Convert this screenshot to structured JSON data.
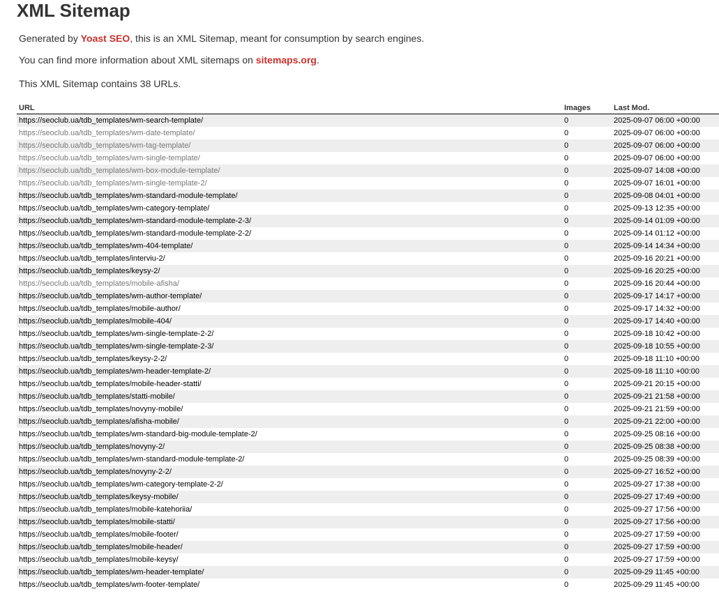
{
  "page": {
    "title": "XML Sitemap"
  },
  "intro": {
    "line1_prefix": "Generated by ",
    "line1_link": "Yoast SEO",
    "line1_suffix": ", this is an XML Sitemap, meant for consumption by search engines.",
    "line2_prefix": "You can find more information about XML sitemaps on ",
    "line2_link": "sitemaps.org",
    "line2_suffix": ".",
    "line3": "This XML Sitemap contains 38 URLs."
  },
  "colors": {
    "link_accent": "#c9302c",
    "row_stripe": "#eeeeee",
    "visited_link": "#777777"
  },
  "table": {
    "headers": {
      "url": "URL",
      "images": "Images",
      "last_mod": "Last Mod."
    },
    "rows": [
      {
        "url": "https://seoclub.ua/tdb_templates/wm-search-template/",
        "images": "0",
        "last_mod": "2025-09-07 06:00 +00:00",
        "visited": false
      },
      {
        "url": "https://seoclub.ua/tdb_templates/wm-date-template/",
        "images": "0",
        "last_mod": "2025-09-07 06:00 +00:00",
        "visited": true
      },
      {
        "url": "https://seoclub.ua/tdb_templates/wm-tag-template/",
        "images": "0",
        "last_mod": "2025-09-07 06:00 +00:00",
        "visited": true
      },
      {
        "url": "https://seoclub.ua/tdb_templates/wm-single-template/",
        "images": "0",
        "last_mod": "2025-09-07 06:00 +00:00",
        "visited": true
      },
      {
        "url": "https://seoclub.ua/tdb_templates/wm-box-module-template/",
        "images": "0",
        "last_mod": "2025-09-07 14:08 +00:00",
        "visited": true
      },
      {
        "url": "https://seoclub.ua/tdb_templates/wm-single-template-2/",
        "images": "0",
        "last_mod": "2025-09-07 16:01 +00:00",
        "visited": true
      },
      {
        "url": "https://seoclub.ua/tdb_templates/wm-standard-module-template/",
        "images": "0",
        "last_mod": "2025-09-08 04:01 +00:00",
        "visited": false
      },
      {
        "url": "https://seoclub.ua/tdb_templates/wm-category-template/",
        "images": "0",
        "last_mod": "2025-09-13 12:35 +00:00",
        "visited": false
      },
      {
        "url": "https://seoclub.ua/tdb_templates/wm-standard-module-template-2-3/",
        "images": "0",
        "last_mod": "2025-09-14 01:09 +00:00",
        "visited": false
      },
      {
        "url": "https://seoclub.ua/tdb_templates/wm-standard-module-template-2-2/",
        "images": "0",
        "last_mod": "2025-09-14 01:12 +00:00",
        "visited": false
      },
      {
        "url": "https://seoclub.ua/tdb_templates/wm-404-template/",
        "images": "0",
        "last_mod": "2025-09-14 14:34 +00:00",
        "visited": false
      },
      {
        "url": "https://seoclub.ua/tdb_templates/interviu-2/",
        "images": "0",
        "last_mod": "2025-09-16 20:21 +00:00",
        "visited": false
      },
      {
        "url": "https://seoclub.ua/tdb_templates/keysy-2/",
        "images": "0",
        "last_mod": "2025-09-16 20:25 +00:00",
        "visited": false
      },
      {
        "url": "https://seoclub.ua/tdb_templates/mobile-afisha/",
        "images": "0",
        "last_mod": "2025-09-16 20:44 +00:00",
        "visited": true
      },
      {
        "url": "https://seoclub.ua/tdb_templates/wm-author-template/",
        "images": "0",
        "last_mod": "2025-09-17 14:17 +00:00",
        "visited": false
      },
      {
        "url": "https://seoclub.ua/tdb_templates/mobile-author/",
        "images": "0",
        "last_mod": "2025-09-17 14:32 +00:00",
        "visited": false
      },
      {
        "url": "https://seoclub.ua/tdb_templates/mobile-404/",
        "images": "0",
        "last_mod": "2025-09-17 14:40 +00:00",
        "visited": false
      },
      {
        "url": "https://seoclub.ua/tdb_templates/wm-single-template-2-2/",
        "images": "0",
        "last_mod": "2025-09-18 10:42 +00:00",
        "visited": false
      },
      {
        "url": "https://seoclub.ua/tdb_templates/wm-single-template-2-3/",
        "images": "0",
        "last_mod": "2025-09-18 10:55 +00:00",
        "visited": false
      },
      {
        "url": "https://seoclub.ua/tdb_templates/keysy-2-2/",
        "images": "0",
        "last_mod": "2025-09-18 11:10 +00:00",
        "visited": false
      },
      {
        "url": "https://seoclub.ua/tdb_templates/wm-header-template-2/",
        "images": "0",
        "last_mod": "2025-09-18 11:10 +00:00",
        "visited": false
      },
      {
        "url": "https://seoclub.ua/tdb_templates/mobile-header-statti/",
        "images": "0",
        "last_mod": "2025-09-21 20:15 +00:00",
        "visited": false
      },
      {
        "url": "https://seoclub.ua/tdb_templates/statti-mobile/",
        "images": "0",
        "last_mod": "2025-09-21 21:58 +00:00",
        "visited": false
      },
      {
        "url": "https://seoclub.ua/tdb_templates/novyny-mobile/",
        "images": "0",
        "last_mod": "2025-09-21 21:59 +00:00",
        "visited": false
      },
      {
        "url": "https://seoclub.ua/tdb_templates/afisha-mobile/",
        "images": "0",
        "last_mod": "2025-09-21 22:00 +00:00",
        "visited": false
      },
      {
        "url": "https://seoclub.ua/tdb_templates/wm-standard-big-module-template-2/",
        "images": "0",
        "last_mod": "2025-09-25 08:16 +00:00",
        "visited": false
      },
      {
        "url": "https://seoclub.ua/tdb_templates/novyny-2/",
        "images": "0",
        "last_mod": "2025-09-25 08:38 +00:00",
        "visited": false
      },
      {
        "url": "https://seoclub.ua/tdb_templates/wm-standard-module-template-2/",
        "images": "0",
        "last_mod": "2025-09-25 08:39 +00:00",
        "visited": false
      },
      {
        "url": "https://seoclub.ua/tdb_templates/novyny-2-2/",
        "images": "0",
        "last_mod": "2025-09-27 16:52 +00:00",
        "visited": false
      },
      {
        "url": "https://seoclub.ua/tdb_templates/wm-category-template-2-2/",
        "images": "0",
        "last_mod": "2025-09-27 17:38 +00:00",
        "visited": false
      },
      {
        "url": "https://seoclub.ua/tdb_templates/keysy-mobile/",
        "images": "0",
        "last_mod": "2025-09-27 17:49 +00:00",
        "visited": false
      },
      {
        "url": "https://seoclub.ua/tdb_templates/mobile-katehoriia/",
        "images": "0",
        "last_mod": "2025-09-27 17:56 +00:00",
        "visited": false
      },
      {
        "url": "https://seoclub.ua/tdb_templates/mobile-statti/",
        "images": "0",
        "last_mod": "2025-09-27 17:56 +00:00",
        "visited": false
      },
      {
        "url": "https://seoclub.ua/tdb_templates/mobile-footer/",
        "images": "0",
        "last_mod": "2025-09-27 17:59 +00:00",
        "visited": false
      },
      {
        "url": "https://seoclub.ua/tdb_templates/mobile-header/",
        "images": "0",
        "last_mod": "2025-09-27 17:59 +00:00",
        "visited": false
      },
      {
        "url": "https://seoclub.ua/tdb_templates/mobile-keysy/",
        "images": "0",
        "last_mod": "2025-09-27 17:59 +00:00",
        "visited": false
      },
      {
        "url": "https://seoclub.ua/tdb_templates/wm-header-template/",
        "images": "0",
        "last_mod": "2025-09-29 11:45 +00:00",
        "visited": false
      },
      {
        "url": "https://seoclub.ua/tdb_templates/wm-footer-template/",
        "images": "0",
        "last_mod": "2025-09-29 11:45 +00:00",
        "visited": false
      }
    ]
  }
}
